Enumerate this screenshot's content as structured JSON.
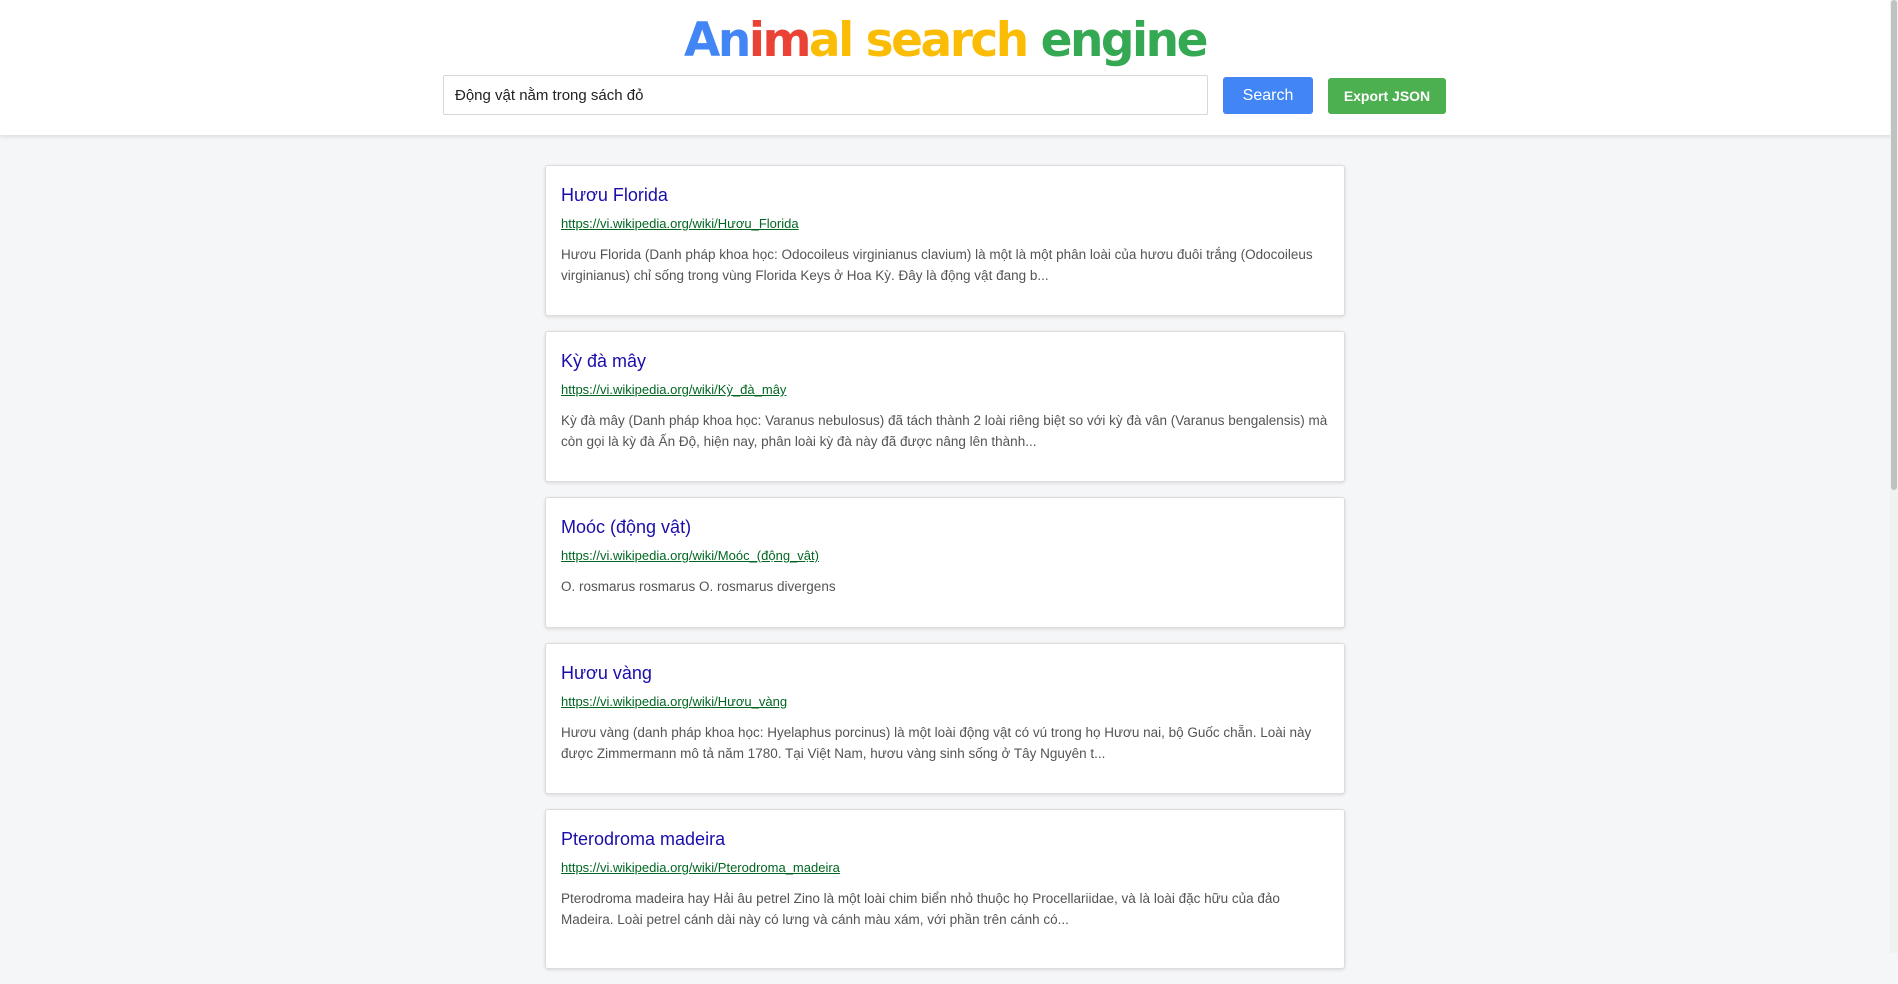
{
  "header": {
    "logo": {
      "segments": [
        {
          "text": "An",
          "color": "#4285f4"
        },
        {
          "text": "im",
          "color": "#ea4335"
        },
        {
          "text": "al",
          "color": "#fbbc05"
        },
        {
          "text": " ",
          "color": "#ffffff"
        },
        {
          "text": "search",
          "color": "#fbbc05"
        },
        {
          "text": " ",
          "color": "#ffffff"
        },
        {
          "text": "engine",
          "color": "#34a853"
        }
      ]
    },
    "search": {
      "value": "Động vật nằm trong sách đỏ"
    },
    "search_button_label": "Search",
    "export_button_label": "Export JSON"
  },
  "colors": {
    "search_button": "#4285f4",
    "export_button": "#4caf50",
    "title_link": "#1a0dab",
    "url_link": "#006621"
  },
  "results": [
    {
      "title": "Hươu Florida",
      "url": "https://vi.wikipedia.org/wiki/Hươu_Florida",
      "snippet": "Hươu Florida (Danh pháp khoa học: Odocoileus virginianus clavium) là một là một phân loài của hươu đuôi trắng (Odocoileus virginianus) chỉ sống trong vùng Florida Keys ở Hoa Kỳ. Đây là động vật đang b..."
    },
    {
      "title": "Kỳ đà mây",
      "url": "https://vi.wikipedia.org/wiki/Kỳ_đà_mây",
      "snippet": "Kỳ đà mây (Danh pháp khoa học: Varanus nebulosus) đã tách thành 2 loài riêng biệt so với kỳ đà vân (Varanus bengalensis) mà còn gọi là kỳ đà Ấn Độ, hiện nay, phân loài kỳ đà này đã được nâng lên thành..."
    },
    {
      "title": "Moóc (động vật)",
      "url": "https://vi.wikipedia.org/wiki/Moóc_(động_vật)",
      "snippet": "O. rosmarus rosmarus O. rosmarus divergens"
    },
    {
      "title": "Hươu vàng",
      "url": "https://vi.wikipedia.org/wiki/Hươu_vàng",
      "snippet": "Hươu vàng (danh pháp khoa học: Hyelaphus porcinus) là một loài động vật có vú trong họ Hươu nai, bộ Guốc chẵn. Loài này được Zimmermann mô tả năm 1780. Tại Việt Nam, hươu vàng sinh sống ở Tây Nguyên t..."
    },
    {
      "title": "Pterodroma madeira",
      "url": "https://vi.wikipedia.org/wiki/Pterodroma_madeira",
      "snippet": "Pterodroma madeira hay Hải âu petrel Zino là một loài chim biển nhỏ thuộc họ Procellariidae, và là loài đặc hữu của đảo Madeira. Loài petrel cánh dài này có lưng và cánh màu xám, với phần trên cánh có..."
    }
  ]
}
